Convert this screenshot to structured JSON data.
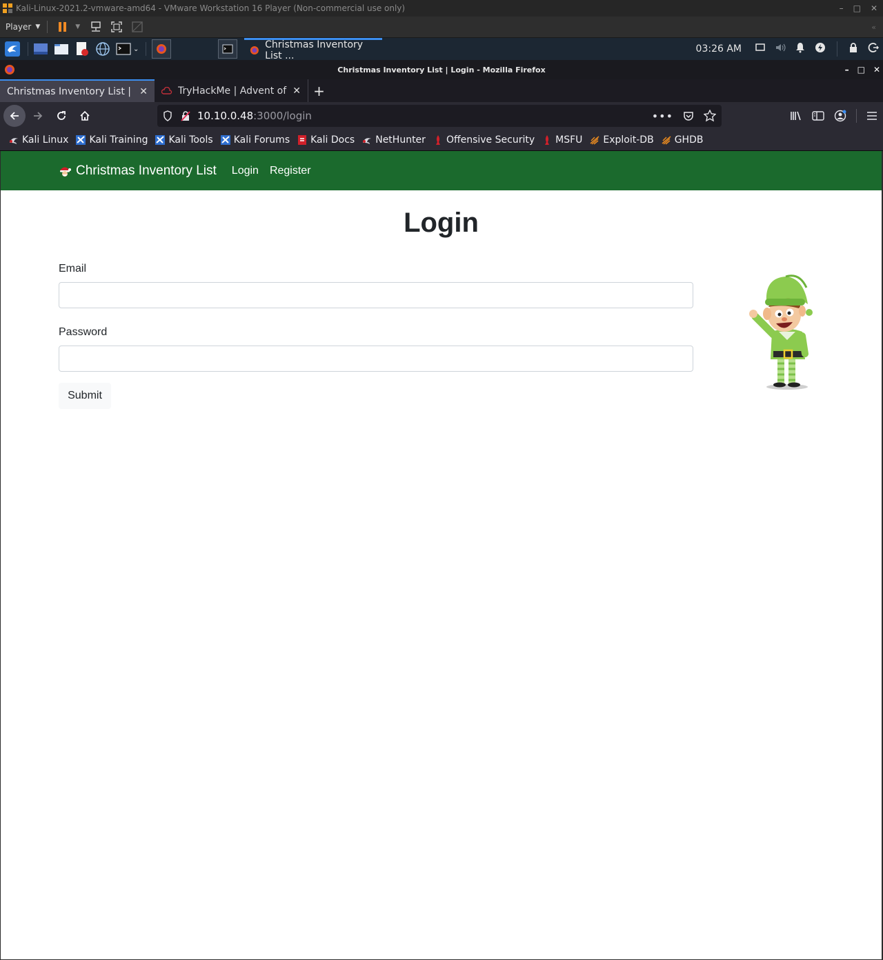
{
  "vmware": {
    "window_title": "Kali-Linux-2021.2-vmware-amd64 - VMware Workstation 16 Player (Non-commercial use only)",
    "player_menu": "Player"
  },
  "kali_panel": {
    "active_task": "Christmas Inventory List ...",
    "clock": "03:26 AM"
  },
  "firefox": {
    "window_title": "Christmas Inventory List | Login - Mozilla Firefox",
    "tabs": [
      {
        "label": "Christmas Inventory List | Lo"
      },
      {
        "label": "TryHackMe | Advent of C"
      }
    ],
    "url": {
      "host": "10.10.0.48",
      "path": ":3000/login"
    },
    "bookmarks": [
      {
        "label": "Kali Linux",
        "icon": "kali-dragon-icon"
      },
      {
        "label": "Kali Training",
        "icon": "kali-training-icon"
      },
      {
        "label": "Kali Tools",
        "icon": "kali-tools-icon"
      },
      {
        "label": "Kali Forums",
        "icon": "kali-forums-icon"
      },
      {
        "label": "Kali Docs",
        "icon": "kali-docs-icon"
      },
      {
        "label": "NetHunter",
        "icon": "nethunter-icon"
      },
      {
        "label": "Offensive Security",
        "icon": "offsec-icon"
      },
      {
        "label": "MSFU",
        "icon": "msfu-icon"
      },
      {
        "label": "Exploit-DB",
        "icon": "exploitdb-icon"
      },
      {
        "label": "GHDB",
        "icon": "ghdb-icon"
      }
    ]
  },
  "site": {
    "brand": "Christmas Inventory List",
    "nav": {
      "login": "Login",
      "register": "Register"
    },
    "heading": "Login",
    "form": {
      "email_label": "Email",
      "email_value": "",
      "password_label": "Password",
      "password_value": "",
      "submit": "Submit"
    },
    "colors": {
      "navbar": "#1b6a2d"
    }
  }
}
